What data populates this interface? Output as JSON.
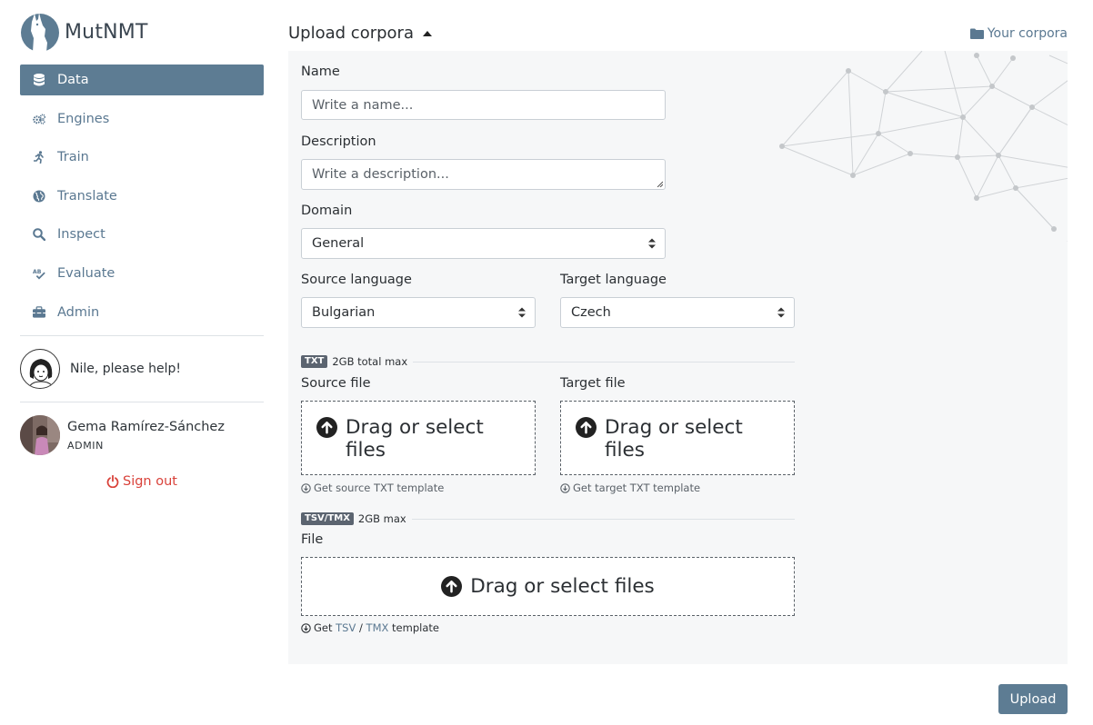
{
  "app": {
    "name": "MutNMT"
  },
  "sidebar": {
    "items": [
      {
        "label": "Data",
        "icon": "database-icon",
        "active": true
      },
      {
        "label": "Engines",
        "icon": "gears-icon",
        "active": false
      },
      {
        "label": "Train",
        "icon": "running-icon",
        "active": false
      },
      {
        "label": "Translate",
        "icon": "globe-icon",
        "active": false
      },
      {
        "label": "Inspect",
        "icon": "search-icon",
        "active": false
      },
      {
        "label": "Evaluate",
        "icon": "spell-check-icon",
        "active": false
      },
      {
        "label": "Admin",
        "icon": "toolbox-icon",
        "active": false
      }
    ],
    "help": {
      "text": "Nile, please help!"
    },
    "user": {
      "name": "Gema Ramírez-Sánchez",
      "role": "ADMIN"
    },
    "signout": {
      "label": "Sign out"
    }
  },
  "header": {
    "title": "Upload corpora",
    "your_corpora": "Your corpora"
  },
  "form": {
    "name": {
      "label": "Name",
      "placeholder": "Write a name..."
    },
    "description": {
      "label": "Description",
      "placeholder": "Write a description..."
    },
    "domain": {
      "label": "Domain",
      "value": "General"
    },
    "source_language": {
      "label": "Source language",
      "value": "Bulgarian"
    },
    "target_language": {
      "label": "Target language",
      "value": "Czech"
    },
    "txt_section": {
      "tag": "TXT",
      "note": "2GB total max"
    },
    "source_file": {
      "label": "Source file",
      "dropzone_line1": "Drag or select",
      "dropzone_line2": "files",
      "template": "Get source TXT template"
    },
    "target_file": {
      "label": "Target file",
      "dropzone_line1": "Drag or select",
      "dropzone_line2": "files",
      "template": "Get target TXT template"
    },
    "tsv_section": {
      "tag": "TSV/TMX",
      "note": "2GB max"
    },
    "file": {
      "label": "File",
      "dropzone": "Drag or select files",
      "template_prefix": "Get",
      "template_tsv": "TSV",
      "template_sep": "/",
      "template_tmx": "TMX",
      "template_suffix": "template"
    }
  },
  "actions": {
    "upload": "Upload"
  },
  "colors": {
    "accent": "#5d7c93",
    "link": "#5a7891",
    "danger": "#d9423a",
    "panel_bg": "#f6f7f8"
  }
}
